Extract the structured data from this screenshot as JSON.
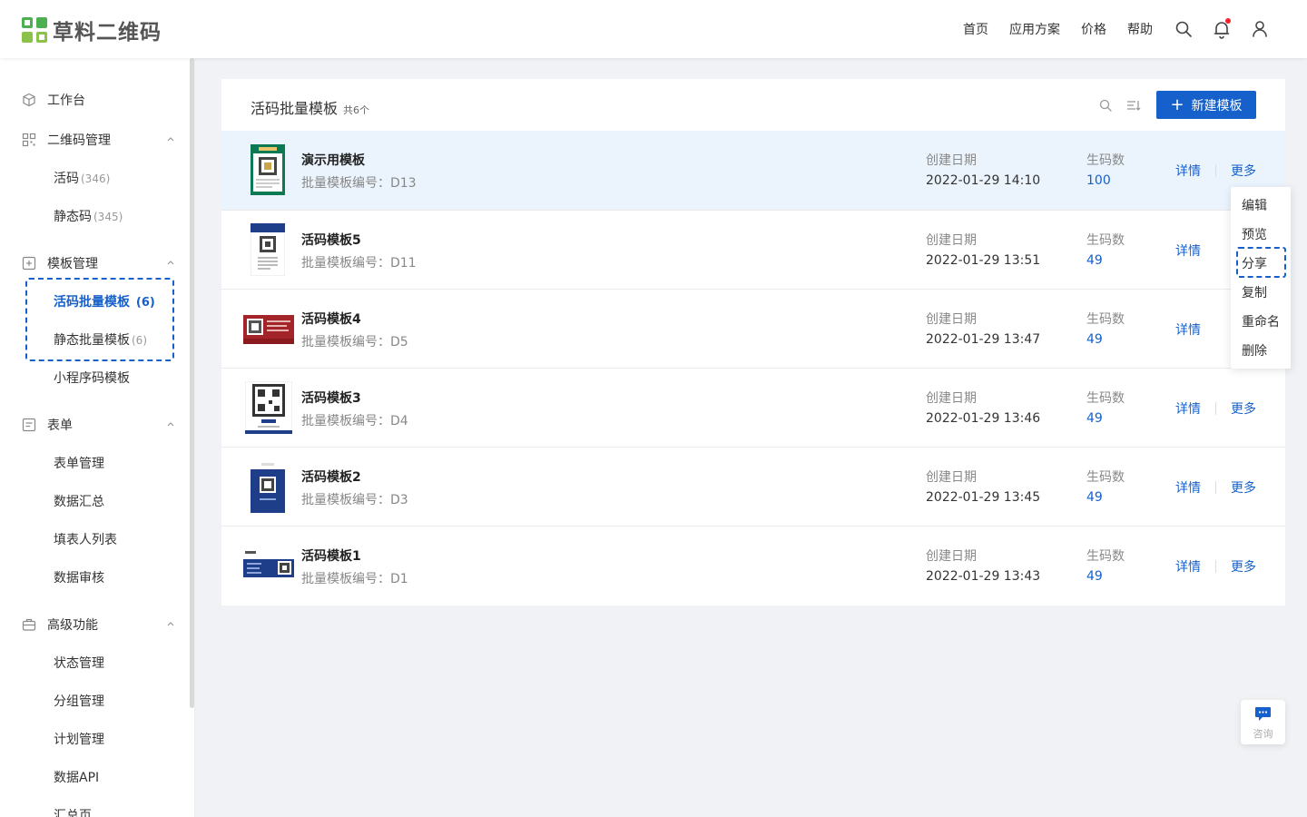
{
  "brand": {
    "name": "草料二维码",
    "colors": {
      "green": "#4caf50",
      "lightgreen": "#8bc34a"
    }
  },
  "topnav": {
    "items": [
      "首页",
      "应用方案",
      "价格",
      "帮助"
    ]
  },
  "topicons": [
    "search-icon",
    "bell-icon",
    "user-icon"
  ],
  "sidebar": {
    "workbench": "工作台",
    "qr_manage": {
      "label": "二维码管理",
      "items": [
        {
          "label": "活码",
          "count": "(346)"
        },
        {
          "label": "静态码",
          "count": "(345)"
        }
      ]
    },
    "template_manage": {
      "label": "模板管理",
      "items": [
        {
          "label": "活码批量模板",
          "count": "(6)"
        },
        {
          "label": "静态批量模板",
          "count": "(6)"
        },
        {
          "label": "小程序码模板",
          "count": ""
        }
      ]
    },
    "form": {
      "label": "表单",
      "items": [
        {
          "label": "表单管理"
        },
        {
          "label": "数据汇总"
        },
        {
          "label": "填表人列表"
        },
        {
          "label": "数据审核"
        }
      ]
    },
    "advanced": {
      "label": "高级功能",
      "items": [
        {
          "label": "状态管理"
        },
        {
          "label": "分组管理"
        },
        {
          "label": "计划管理"
        },
        {
          "label": "数据API"
        },
        {
          "label": "汇总页"
        }
      ]
    }
  },
  "main": {
    "title": "活码批量模板",
    "count": "共6个",
    "new_button": "新建模板",
    "created_label": "创建日期",
    "count_label": "生码数",
    "detail_label": "详情",
    "more_label": "更多",
    "rows": [
      {
        "name": "演示用模板",
        "code": "批量模板编号：D13",
        "date": "2022-01-29 14:10",
        "count": "100"
      },
      {
        "name": "活码模板5",
        "code": "批量模板编号：D11",
        "date": "2022-01-29 13:51",
        "count": "49"
      },
      {
        "name": "活码模板4",
        "code": "批量模板编号：D5",
        "date": "2022-01-29 13:47",
        "count": "49"
      },
      {
        "name": "活码模板3",
        "code": "批量模板编号：D4",
        "date": "2022-01-29 13:46",
        "count": "49"
      },
      {
        "name": "活码模板2",
        "code": "批量模板编号：D3",
        "date": "2022-01-29 13:45",
        "count": "49"
      },
      {
        "name": "活码模板1",
        "code": "批量模板编号：D1",
        "date": "2022-01-29 13:43",
        "count": "49"
      }
    ]
  },
  "dropdown": {
    "items": [
      "编辑",
      "预览",
      "分享",
      "复制",
      "重命名",
      "删除"
    ]
  },
  "consult": {
    "label": "咨询"
  },
  "colors": {
    "primary": "#1660cc",
    "row_highlight": "#ebf4fd"
  }
}
